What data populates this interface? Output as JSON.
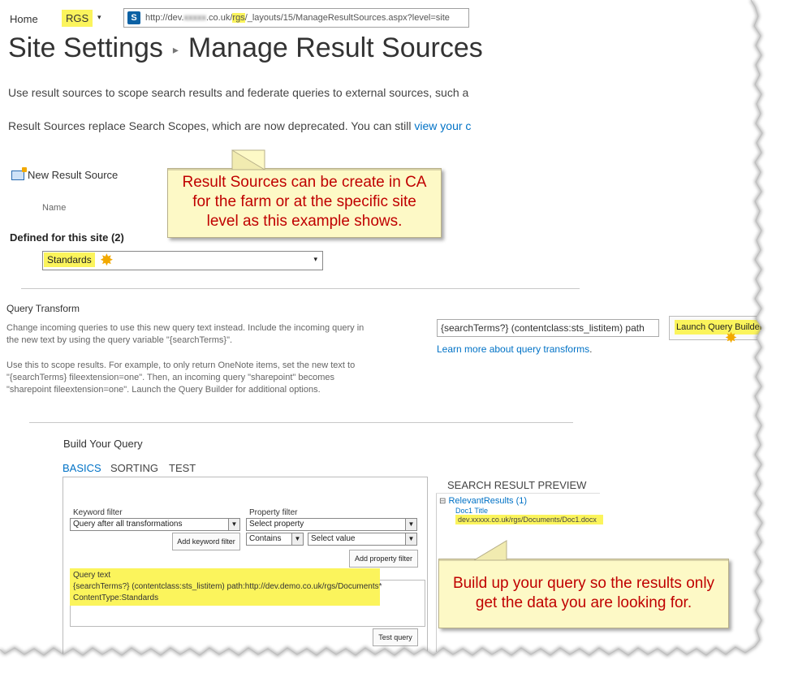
{
  "topnav": {
    "home": "Home",
    "site": "RGS",
    "site_caret": "▾",
    "url_prefix": "http://dev.",
    "url_masked": "xxxxx",
    "url_mid": ".co.uk/",
    "url_rgs": "rgs",
    "url_suffix": "/_layouts/15/ManageResultSources.aspx?level=site"
  },
  "page": {
    "breadcrumb_root": "Site Settings",
    "breadcrumb_sep": "▸",
    "breadcrumb_current": "Manage Result Sources",
    "description_1": "Use result sources to scope search results and federate queries to external sources, such a",
    "description_2_prefix": "Result Sources replace Search Scopes, which are now deprecated. You can still ",
    "description_2_link": "view your c"
  },
  "callout_top": "Result Sources can be create in CA for the farm or at the specific site level as this example shows.",
  "result_sources": {
    "new_label": "New Result Source",
    "col_name": "Name",
    "defined_heading": "Defined for this site (2)",
    "selected": "Standards",
    "arrow": "▾"
  },
  "query_transform": {
    "title": "Query Transform",
    "desc_1a": "Change incoming queries to use this new query text instead. Include the incoming query in",
    "desc_1b": "the new text by using the query variable \"{searchTerms}\".",
    "desc_2a": "Use this to scope results. For example, to only return OneNote items, set the new text to",
    "desc_2b": "\"{searchTerms} fileextension=one\". Then, an incoming query \"sharepoint\" becomes",
    "desc_2c": "\"sharepoint fileextension=one\". Launch the Query Builder for additional options.",
    "input_value": "{searchTerms?} (contentclass:sts_listitem) path",
    "launch_button": "Launch Query Builder",
    "learn_link": "Learn more about query transforms",
    "learn_period": "."
  },
  "build_query": {
    "title": "Build Your Query",
    "tabs": [
      "BASICS",
      "SORTING",
      "TEST"
    ],
    "keyword_filter_label": "Keyword filter",
    "keyword_filter_value": "Query after all transformations",
    "add_keyword_button": "Add keyword filter",
    "property_filter_label": "Property filter",
    "property_select": "Select property",
    "operator_select": "Contains",
    "value_select": "Select value",
    "add_property_button": "Add property filter",
    "query_text_label": "Query text",
    "query_text_line1": "{searchTerms?} (contentclass:sts_listitem) path:http://dev.demo.co.uk/rgs/Documents*",
    "query_text_line2": "ContentType:Standards",
    "test_button": "Test query"
  },
  "preview": {
    "title": "SEARCH RESULT PREVIEW",
    "expander": "⊟",
    "group": "RelevantResults (1)",
    "doc_title": "Doc1 Title",
    "doc_url": "dev.xxxxx.co.uk/rgs/Documents/Doc1.docx"
  },
  "callout_bottom": "Build up your query so the results only get the data you are looking for.",
  "colors": {
    "highlight": "#fbf45c",
    "link": "#0072c6",
    "callout_text": "#c00000",
    "callout_bg": "#fdf9c6"
  }
}
